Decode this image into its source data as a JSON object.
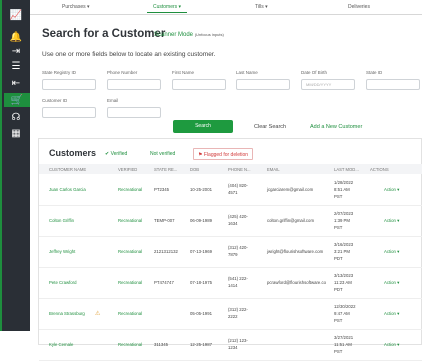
{
  "nav_tabs": [
    "Purchases ▾",
    "Customers ▾",
    "Tills ▾",
    "Deliveries"
  ],
  "sidebar_icons": [
    "chart-icon",
    "bell-icon",
    "login-icon",
    "list-icon",
    "logout-icon",
    "cart-icon",
    "headset-icon",
    "calendar-icon"
  ],
  "page": {
    "title": "Search for a Customer",
    "scanner_mode": "Scanner Mode",
    "scanner_hint": "(Unfocus inputs)",
    "subtitle": "Use one or more fields below to locate an existing customer."
  },
  "form": {
    "state_registry_id_label": "State Registry ID",
    "phone_number_label": "Phone Number",
    "first_name_label": "First Name",
    "last_name_label": "Last Name",
    "dob_label": "Date Of Birth",
    "dob_placeholder": "MM/DD/YYYY",
    "state_id_label": "State ID",
    "customer_id_label": "Customer ID",
    "email_label": "Email",
    "search_button": "Search",
    "clear_search": "Clear Search",
    "add_new_customer": "Add a New Customer"
  },
  "customers": {
    "title": "Customers",
    "filter_verified": "Verified",
    "filter_not_verified": "Not verified",
    "filter_flagged": "Flagged for deletion",
    "columns": [
      "CUSTOMER NAME",
      "VERIFIED",
      "STATE RE...",
      "DOB",
      "PHONE N...",
      "EMAIL",
      "LAST MOD...",
      "ACTIONS"
    ],
    "rows": [
      {
        "name": "Juan Carlos Garcia",
        "type": "Recreational",
        "state_reg": "PT2345",
        "dob": "10-25-2001",
        "phone1": "(404) 820-",
        "phone2": "4571",
        "email": "jcgarciarem@gmail.com",
        "mod1": "1/28/2022",
        "mod2": "8:51 AM",
        "mod3": "PST",
        "action": "Action ▾",
        "warn": ""
      },
      {
        "name": "Colton Griffin",
        "type": "Recreational",
        "state_reg": "TEMP-007",
        "dob": "06-09-1989",
        "phone1": "(425) 420-",
        "phone2": "1634",
        "email": "colton.griffin@gmail.com",
        "mod1": "2/07/2023",
        "mod2": "1:39 PM",
        "mod3": "PST",
        "action": "Action ▾",
        "warn": ""
      },
      {
        "name": "Jeffrey Wright",
        "type": "Recreational",
        "state_reg": "2121312132",
        "dob": "07-13-1969",
        "phone1": "(312) 420-",
        "phone2": "7879",
        "email": "jwright@flourishsoftware.com",
        "mod1": "3/16/2023",
        "mod2": "3:21 PM",
        "mod3": "PDT",
        "action": "Action ▾",
        "warn": ""
      },
      {
        "name": "Pete Crawford",
        "type": "Recreational",
        "state_reg": "PT474747",
        "dob": "07-18-1975",
        "phone1": "(541) 222-",
        "phone2": "1414",
        "email": "pcrawford@flourishsoftware.co",
        "mod1": "3/13/2023",
        "mod2": "11:23 AM",
        "mod3": "PDT",
        "action": "Action ▾",
        "warn": ""
      },
      {
        "name": "Brenna Strassburg",
        "type": "Recreational",
        "state_reg": "",
        "dob": "05-05-1991",
        "phone1": "(312) 222-",
        "phone2": "2222",
        "email": "",
        "mod1": "12/30/2022",
        "mod2": "9:47 AM",
        "mod3": "PST",
        "action": "Action ▾",
        "warn": "⚠"
      },
      {
        "name": "Kyle Cemale",
        "type": "Recreational",
        "state_reg": "311345",
        "dob": "12-25-1987",
        "phone1": "(212) 123-",
        "phone2": "1234",
        "email": "",
        "mod1": "3/27/2021",
        "mod2": "11:51 AM",
        "mod3": "PST",
        "action": "Action ▾",
        "warn": ""
      }
    ]
  }
}
